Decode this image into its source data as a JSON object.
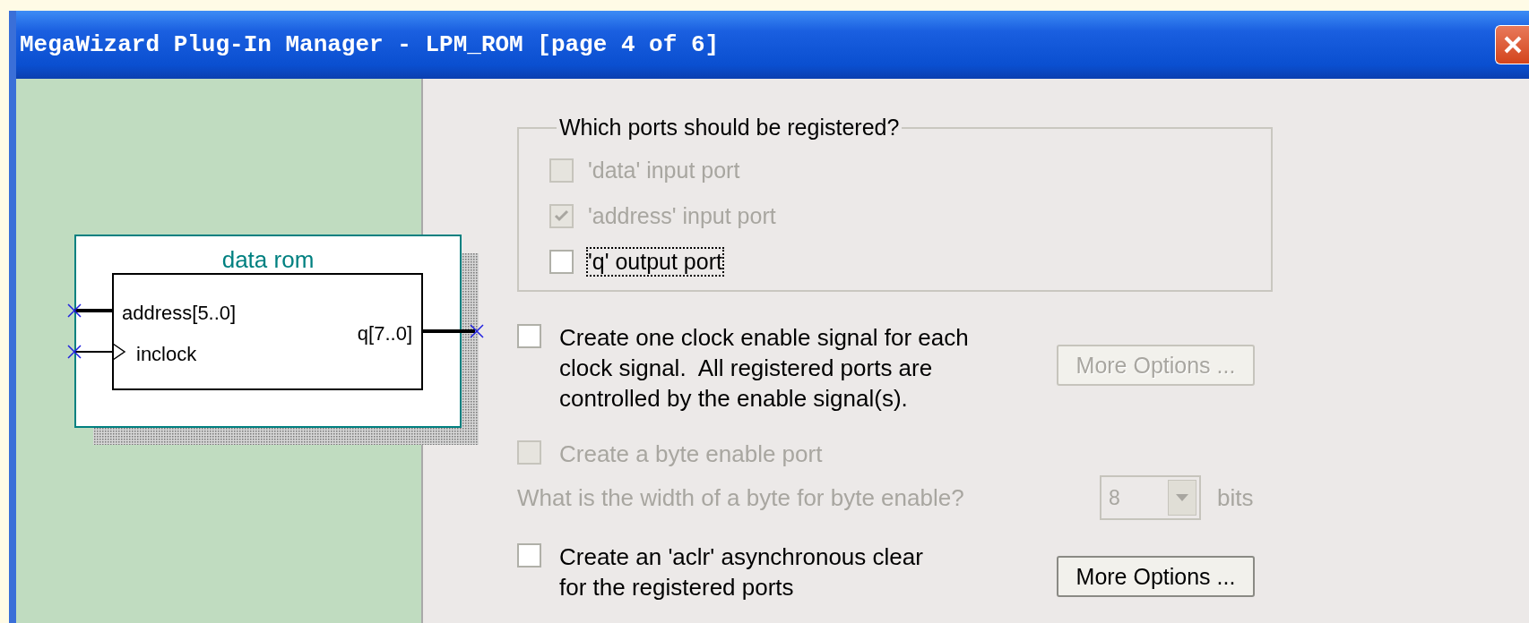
{
  "window": {
    "title": "MegaWizard Plug-In Manager - LPM_ROM [page 4 of 6]"
  },
  "diagram": {
    "title": "data rom",
    "inputs": [
      {
        "label": "address[5..0]",
        "kind": "bus"
      },
      {
        "label": "inclock",
        "kind": "clock"
      }
    ],
    "outputs": [
      {
        "label": "q[7..0]",
        "kind": "bus"
      }
    ]
  },
  "register_group": {
    "label": "Which ports should be registered?",
    "options": [
      {
        "label": "'data' input port",
        "checked": false,
        "disabled": true,
        "focused": false
      },
      {
        "label": "'address' input port",
        "checked": true,
        "disabled": true,
        "focused": false
      },
      {
        "label": "'q' output port",
        "checked": false,
        "disabled": false,
        "focused": true
      }
    ]
  },
  "options": [
    {
      "kind": "checkbox",
      "label": "Create one clock enable signal for each clock signal.  All registered ports are controlled by the enable signal(s).",
      "checked": false,
      "disabled": false,
      "button": {
        "label": "More Options ...",
        "disabled": true
      }
    },
    {
      "kind": "checkbox",
      "label": "Create a byte enable port",
      "checked": false,
      "disabled": true
    },
    {
      "kind": "select",
      "label": "What is the width of a byte for byte enable?",
      "value": "8",
      "unit": "bits",
      "disabled": true
    },
    {
      "kind": "checkbox",
      "label": "Create an 'aclr' asynchronous clear for the registered ports",
      "checked": false,
      "disabled": false,
      "button": {
        "label": "More Options ...",
        "disabled": false
      }
    }
  ]
}
